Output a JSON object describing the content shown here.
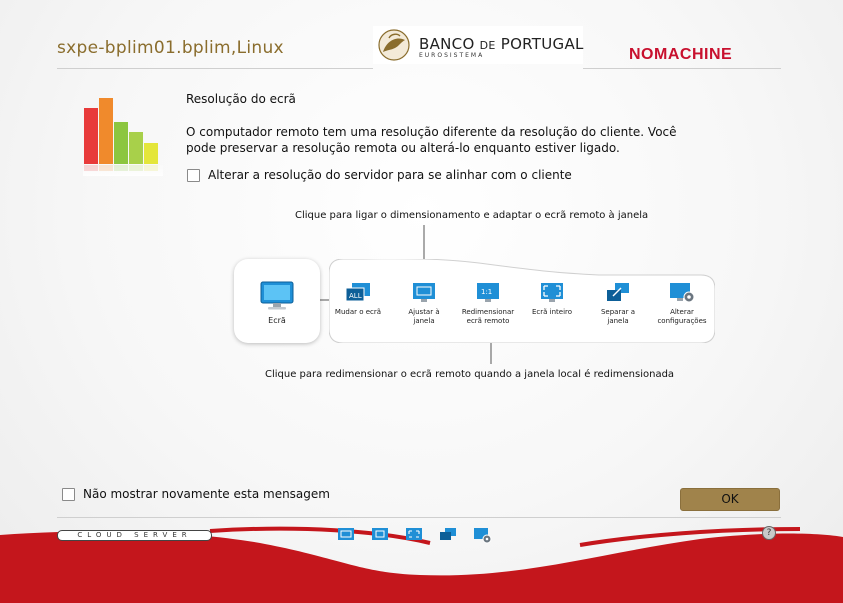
{
  "window": {
    "title": "sxpe-bplim01.bplim,Linux"
  },
  "branding": {
    "bank_name_a": "BANCO ",
    "bank_name_de": "DE",
    "bank_name_b": " PORTUGAL",
    "bank_sub": "EUROSISTEMA",
    "vendor": "NOMACHINE"
  },
  "dialog": {
    "heading": "Resolução do ecrã",
    "description": "O computador remoto tem uma resolução diferente da resolução do cliente. Você pode preservar a resolução remota ou alterá-lo enquanto estiver ligado.",
    "change_resolution_label": "Alterar a resolução do servidor para se alinhar com o cliente",
    "change_resolution_checked": false
  },
  "diagram": {
    "callout_top": "Clique para ligar o dimensionamento e adaptar o ecrã remoto à janela",
    "callout_bottom": "Clique para redimensionar o ecrã remoto quando a janela local é redimensionada",
    "screen_label": "Ecrã",
    "items": [
      {
        "line1": "Mudar o ecrã",
        "line2": "",
        "icon": "change-screen-icon"
      },
      {
        "line1": "Ajustar à",
        "line2": "janela",
        "icon": "fit-to-window-icon"
      },
      {
        "line1": "Redimensionar",
        "line2": "ecrã remoto",
        "icon": "resize-remote-screen-icon"
      },
      {
        "line1": "Ecrã inteiro",
        "line2": "",
        "icon": "fullscreen-icon"
      },
      {
        "line1": "Separar a janela",
        "line2": "",
        "icon": "detach-window-icon"
      },
      {
        "line1": "Alterar",
        "line2": "configurações",
        "icon": "settings-icon"
      }
    ]
  },
  "footer": {
    "dont_show_label": "Não mostrar novamente esta mensagem",
    "dont_show_checked": false,
    "ok_label": "OK",
    "cloud_label": "CLOUD SERVER",
    "help_glyph": "?"
  },
  "colors": {
    "accent_gold": "#a0834b",
    "brand_red": "#c8102e",
    "title_gold": "#8a6d2d"
  }
}
